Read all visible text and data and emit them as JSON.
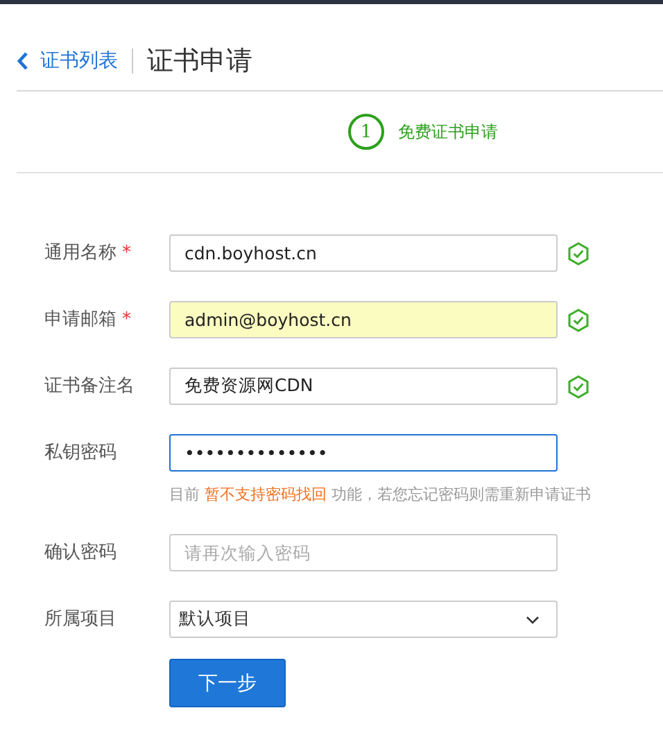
{
  "header": {
    "back_link": "证书列表",
    "title": "证书申请"
  },
  "steps": [
    {
      "number": "1",
      "label": "免费证书申请",
      "selected": true
    }
  ],
  "fields": [
    {
      "kind": "text",
      "label": "通用名称",
      "required_mark": "*",
      "value": "cdn.boyhost.cn",
      "valid": true,
      "autofilled": false,
      "focused": false
    },
    {
      "kind": "text",
      "label": "申请邮箱",
      "required_mark": "*",
      "value": "admin@boyhost.cn",
      "valid": true,
      "autofilled": true,
      "focused": false
    },
    {
      "kind": "text",
      "label": "证书备注名",
      "value": "免费资源网CDN",
      "valid": true,
      "autofilled": false,
      "focused": false
    },
    {
      "kind": "text",
      "label": "私钥密码",
      "value": "••••••••••••••",
      "valid": false,
      "autofilled": false,
      "focused": true,
      "hint": "目前 **暂不支持密码找回** 功能，若您忘记密码则需重新申请证书"
    },
    {
      "kind": "text",
      "label": "确认密码",
      "placeholder": "请再次输入密码",
      "valid": false,
      "autofilled": false,
      "focused": false
    },
    {
      "kind": "select",
      "label": "所属项目",
      "value": "默认项目",
      "valid": false
    }
  ],
  "submit_button": "下一步"
}
